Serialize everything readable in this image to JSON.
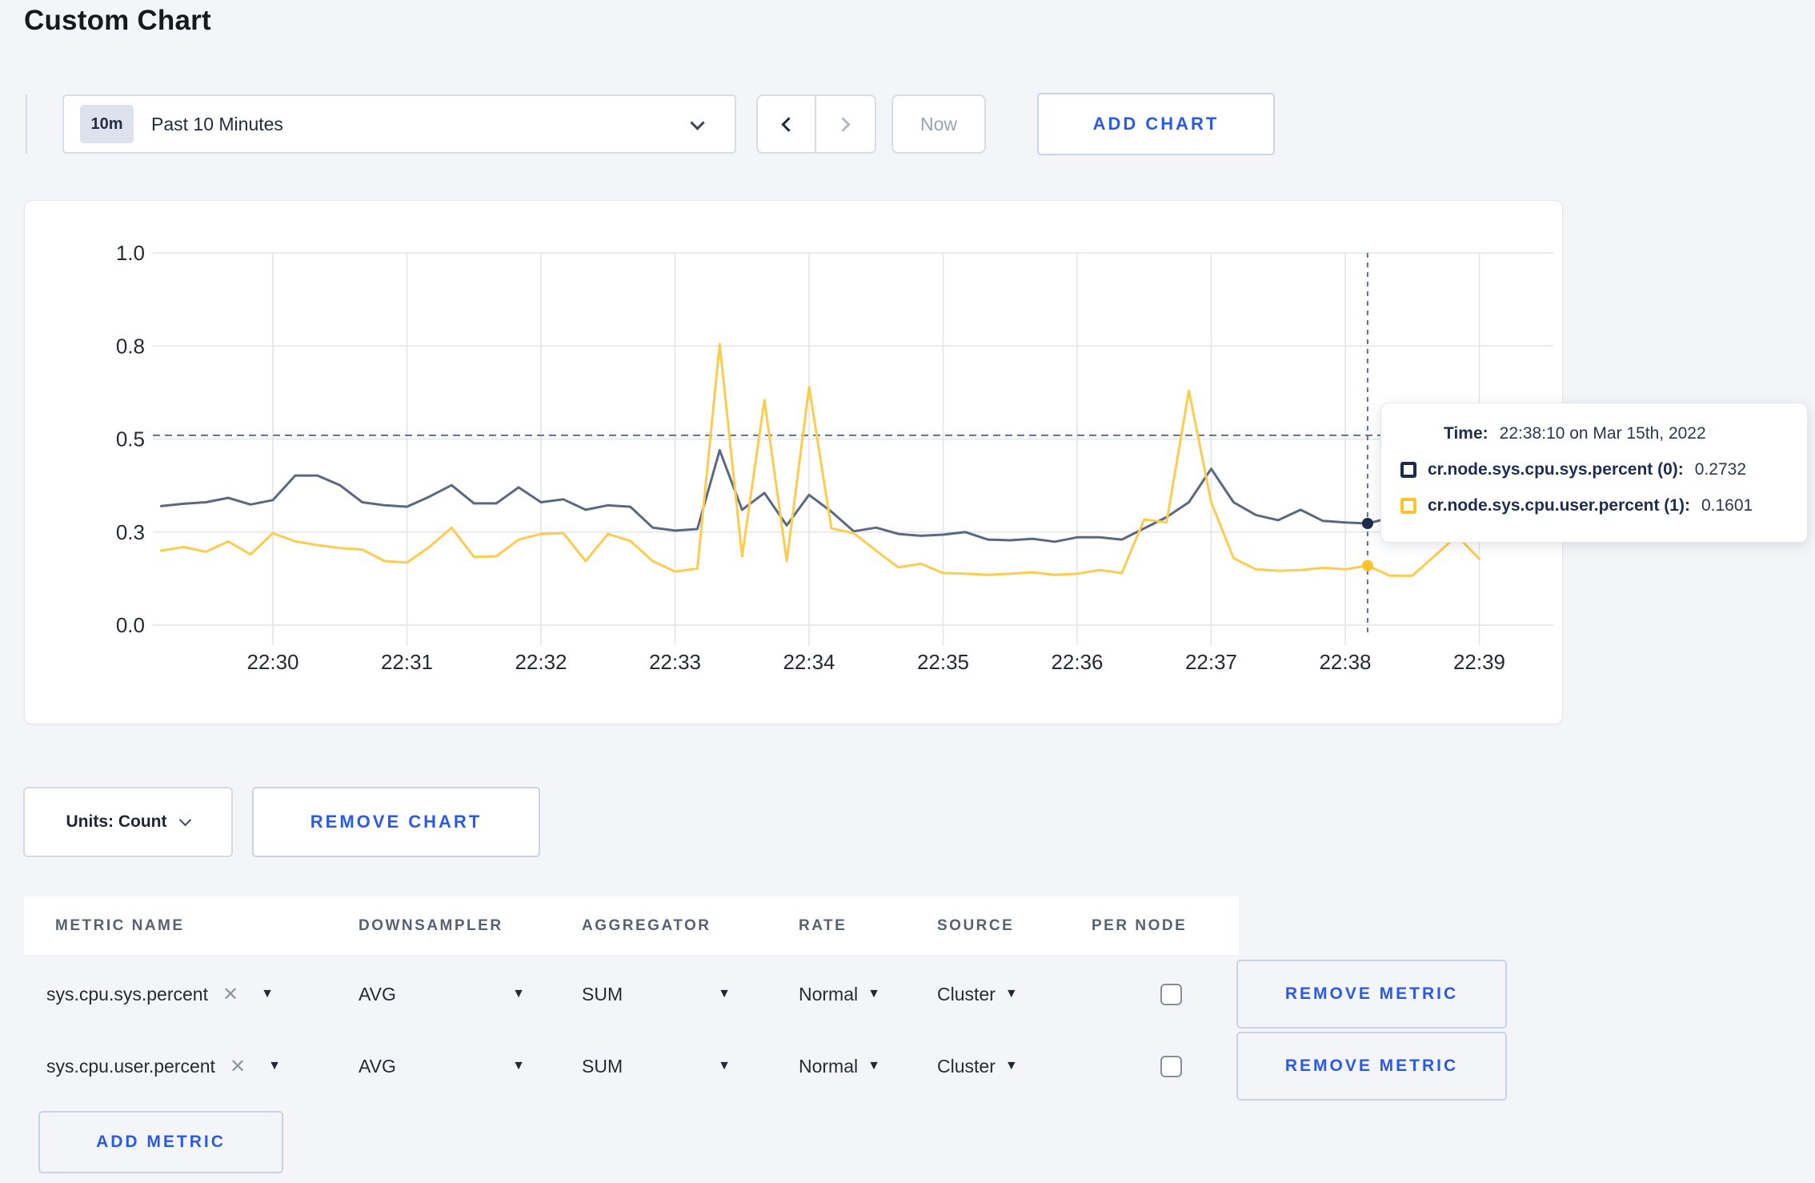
{
  "page": {
    "title": "Custom Chart"
  },
  "toolbar": {
    "range_badge": "10m",
    "range_label": "Past 10 Minutes",
    "now_label": "Now",
    "add_chart_label": "ADD CHART"
  },
  "chart_data": {
    "type": "line",
    "title": "",
    "xlabel": "",
    "ylabel": "",
    "ylim": [
      0,
      1
    ],
    "grid": true,
    "y_tick_labels": [
      "1.0",
      "0.8",
      "0.5",
      "0.3",
      "0.0"
    ],
    "y_tick_values": [
      1.0,
      0.75,
      0.5,
      0.25,
      0.0
    ],
    "x_tick_labels": [
      "22:30",
      "22:31",
      "22:32",
      "22:33",
      "22:34",
      "22:35",
      "22:36",
      "22:37",
      "22:38",
      "22:39"
    ],
    "x_start_time": "22:29:10",
    "x_step_seconds": 10,
    "x_offset_seconds_before_first_tick": 50,
    "series": [
      {
        "name": "cr.node.sys.cpu.sys.percent (0)",
        "color": "#5b6882",
        "swatch_color": "#1c2b4d",
        "values": [
          0.32,
          0.326,
          0.33,
          0.342,
          0.324,
          0.336,
          0.402,
          0.402,
          0.376,
          0.33,
          0.322,
          0.318,
          0.345,
          0.376,
          0.327,
          0.327,
          0.37,
          0.33,
          0.338,
          0.31,
          0.322,
          0.318,
          0.262,
          0.254,
          0.258,
          0.47,
          0.31,
          0.355,
          0.268,
          0.35,
          0.305,
          0.252,
          0.262,
          0.245,
          0.24,
          0.243,
          0.25,
          0.23,
          0.228,
          0.232,
          0.224,
          0.236,
          0.236,
          0.23,
          0.26,
          0.29,
          0.33,
          0.42,
          0.33,
          0.296,
          0.282,
          0.31,
          0.28,
          0.276,
          0.2732,
          0.288,
          0.282,
          0.282,
          0.302,
          0.294
        ]
      },
      {
        "name": "cr.node.sys.cpu.user.percent (1)",
        "color": "#fccc4f",
        "swatch_color": "#fcc32d",
        "values": [
          0.2,
          0.21,
          0.197,
          0.225,
          0.19,
          0.247,
          0.225,
          0.215,
          0.207,
          0.203,
          0.172,
          0.168,
          0.21,
          0.262,
          0.183,
          0.185,
          0.23,
          0.245,
          0.247,
          0.172,
          0.245,
          0.226,
          0.172,
          0.144,
          0.152,
          0.755,
          0.185,
          0.605,
          0.172,
          0.64,
          0.26,
          0.247,
          0.2,
          0.155,
          0.165,
          0.14,
          0.138,
          0.135,
          0.138,
          0.142,
          0.135,
          0.138,
          0.148,
          0.14,
          0.284,
          0.276,
          0.63,
          0.33,
          0.18,
          0.15,
          0.146,
          0.148,
          0.154,
          0.15,
          0.1601,
          0.133,
          0.133,
          0.186,
          0.24,
          0.178
        ]
      }
    ],
    "crosshair": {
      "index": 54,
      "time": "22:38:10",
      "hline_value": 0.51
    },
    "legend_position": "tooltip"
  },
  "tooltip": {
    "time_label": "Time:",
    "time_value": "22:38:10 on Mar 15th, 2022",
    "rows": [
      {
        "label": "cr.node.sys.cpu.sys.percent (0):",
        "value": "0.2732"
      },
      {
        "label": "cr.node.sys.cpu.user.percent (1):",
        "value": "0.1601"
      }
    ]
  },
  "chart_controls": {
    "units_label": "Units: Count",
    "remove_chart_label": "REMOVE CHART"
  },
  "metrics_table": {
    "headers": [
      "METRIC NAME",
      "DOWNSAMPLER",
      "AGGREGATOR",
      "RATE",
      "SOURCE",
      "PER NODE"
    ],
    "rows": [
      {
        "metric": "sys.cpu.sys.percent",
        "remove_icon": "✕",
        "downsampler": "AVG",
        "aggregator": "SUM",
        "rate": "Normal",
        "source": "Cluster",
        "per_node_checked": false,
        "remove_label": "REMOVE METRIC"
      },
      {
        "metric": "sys.cpu.user.percent",
        "remove_icon": "✕",
        "downsampler": "AVG",
        "aggregator": "SUM",
        "rate": "Normal",
        "source": "Cluster",
        "per_node_checked": false,
        "remove_label": "REMOVE METRIC"
      }
    ],
    "add_metric_label": "ADD METRIC"
  },
  "colors": {
    "accent_blue": "#2a5ae8",
    "page_background": "#f4f5f8",
    "gridline": "#e3e4e8",
    "crosshair": "#5d7292",
    "series_sys": "#5b6882",
    "series_user": "#fccc4f"
  }
}
